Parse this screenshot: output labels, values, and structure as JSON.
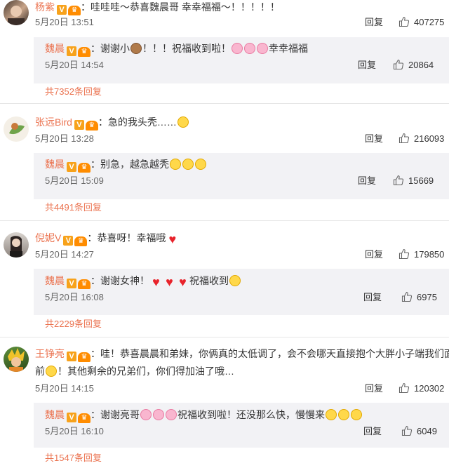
{
  "comments": [
    {
      "user": "杨紫",
      "text": "哇哇哇～恭喜魏晨哥 幸幸福福～！！！！！",
      "time": "5月20日 13:51",
      "reply_label": "回复",
      "likes": "407275",
      "reply": {
        "user": "魏晨",
        "text_a": "谢谢小",
        "text_b": "！！！祝福收到啦！",
        "text_c": "幸幸福福",
        "time": "5月20日 14:54",
        "reply_label": "回复",
        "likes": "20864"
      },
      "total": "共7352条回复"
    },
    {
      "user": "张远Bird",
      "text": "急的我头秃……",
      "time": "5月20日 13:28",
      "reply_label": "回复",
      "likes": "216093",
      "reply": {
        "user": "魏晨",
        "text_a": "别急，越急越秃",
        "time": "5月20日 15:09",
        "reply_label": "回复",
        "likes": "15669"
      },
      "total": "共4491条回复"
    },
    {
      "user": "倪妮V",
      "text": "恭喜呀！幸福哦",
      "time": "5月20日 14:27",
      "reply_label": "回复",
      "likes": "179850",
      "reply": {
        "user": "魏晨",
        "text_a": "谢谢女神！",
        "text_b": "祝福收到",
        "time": "5月20日 16:08",
        "reply_label": "回复",
        "likes": "6975"
      },
      "total": "共2229条回复"
    },
    {
      "user": "王铮亮",
      "text_line1": "哇！恭喜晨晨和弟妹，你俩真的太低调了，会不会哪天直接抱个大胖小子端我们面",
      "text_line2_a": "前",
      "text_line2_b": "！其他剩余的兄弟们，你们得加油了哦…",
      "time": "5月20日 14:15",
      "reply_label": "回复",
      "likes": "120302",
      "reply": {
        "user": "魏晨",
        "text_a": "谢谢亮哥",
        "text_b": "祝福收到啦！还没那么快，慢慢来",
        "time": "5月20日 16:10",
        "reply_label": "回复",
        "likes": "6049"
      },
      "total": "共1547条回复"
    }
  ],
  "badge_text": "V",
  "colors": {
    "username": "#eb7350",
    "reply_bg": "#f2f2f5",
    "badge": "#f7a21b"
  },
  "icons": {
    "like": "thumbs-up-icon",
    "verified": "verified-v-icon",
    "vip": "vip-crown-icon"
  }
}
